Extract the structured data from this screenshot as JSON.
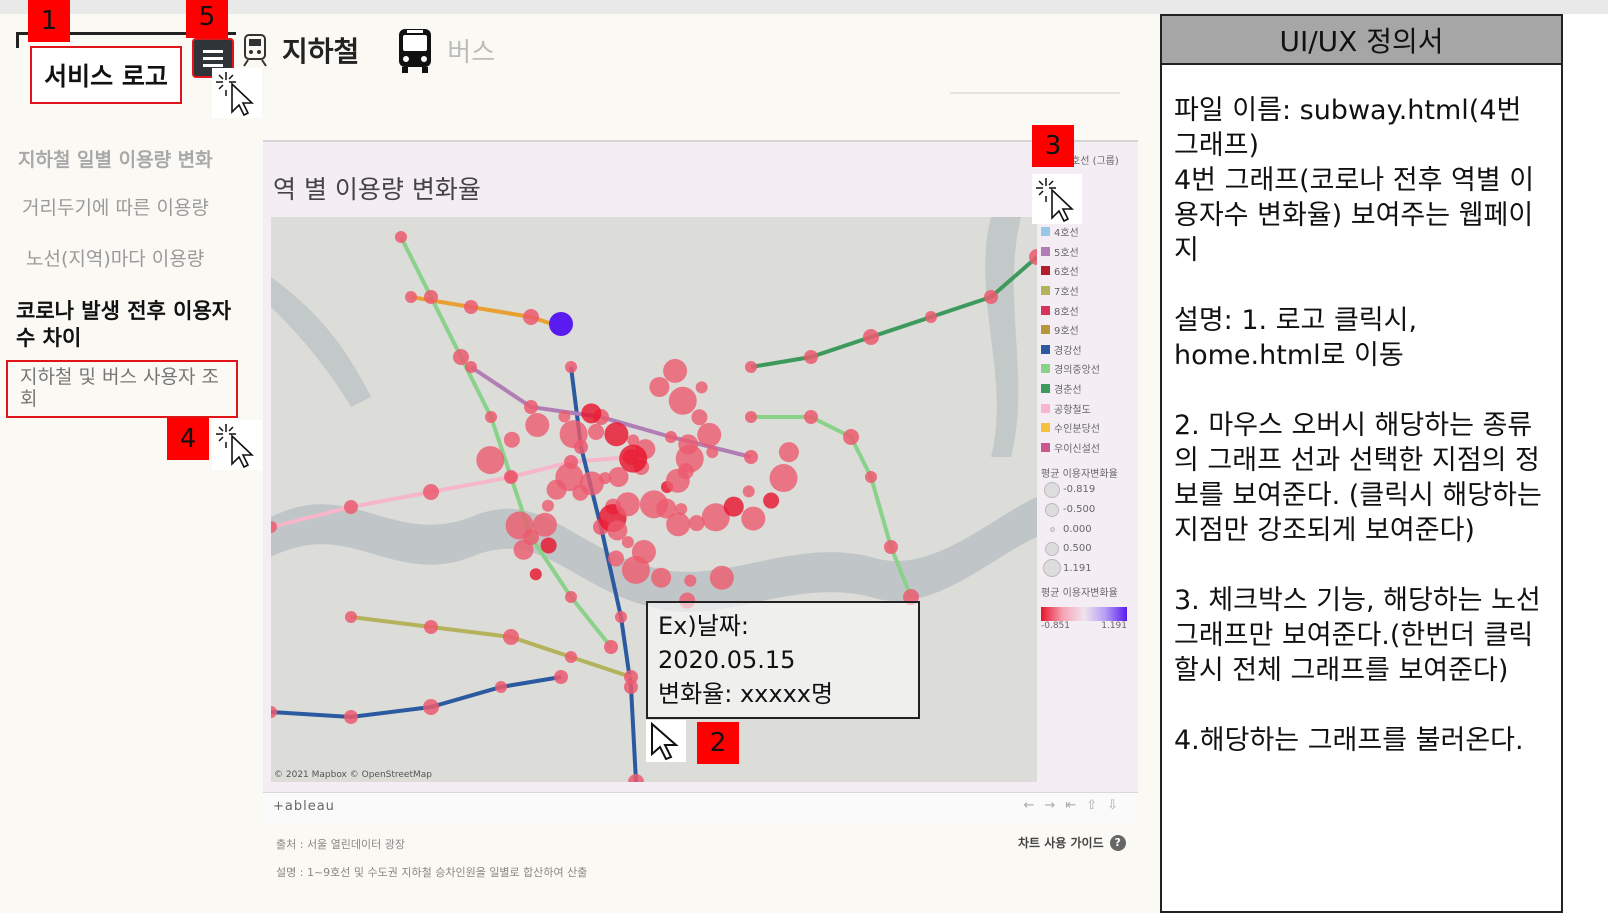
{
  "header": {
    "logo_label": "서비스 로고",
    "nav": [
      {
        "label": "지하철",
        "icon": "train-icon",
        "active": true
      },
      {
        "label": "버스",
        "icon": "bus-icon",
        "active": false
      }
    ]
  },
  "sidebar": {
    "links": [
      "지하철 일별 이용량 변화",
      "거리두기에 따른 이용량",
      "노선(지역)마다 이용량"
    ],
    "section_title": "코로나 발생 전후 이용자 수 차이",
    "active_item": "지하철 및 버스 사용자 조회"
  },
  "chart": {
    "title": "역 별 이용량 변화율",
    "legend_header": "호선 (그룹)",
    "legend_lines": [
      {
        "label": "4호선",
        "color": "#9ac6e8"
      },
      {
        "label": "5호선",
        "color": "#b07db5"
      },
      {
        "label": "6호선",
        "color": "#b71c2d"
      },
      {
        "label": "7호선",
        "color": "#b4b25a"
      },
      {
        "label": "8호선",
        "color": "#d8345a"
      },
      {
        "label": "9호선",
        "color": "#b8963c"
      },
      {
        "label": "경강선",
        "color": "#2c5aa0"
      },
      {
        "label": "경의중앙선",
        "color": "#8ad18a"
      },
      {
        "label": "경춘선",
        "color": "#3d9a5c"
      },
      {
        "label": "공항철도",
        "color": "#f5b7c9"
      },
      {
        "label": "수인분당선",
        "color": "#f3c23d"
      },
      {
        "label": "우이신설선",
        "color": "#c7598f"
      }
    ],
    "size_legend_title": "평균 이용자변화율",
    "size_legend": [
      "-0.819",
      "-0.500",
      "0.000",
      "0.500",
      "1.191"
    ],
    "color_legend_title": "평균 이용자변화율",
    "color_min": "-0.851",
    "color_max": "1.191",
    "map_credit": "© 2021 Mapbox © OpenStreetMap",
    "tableau_label": "+ableau"
  },
  "tooltip": {
    "line1": "Ex)날짜:",
    "line2": "2020.05.15",
    "line3": "변화율: xxxxx명"
  },
  "footer": {
    "source": "출처 : 서울 열린데이터 광장",
    "description": "설명 : 1~9호선 및 수도권 지하철 승차인원을 일별로 합산하여 산출",
    "guide_label": "차트 사용 가이드",
    "guide_icon": "?"
  },
  "annotations": [
    "1",
    "2",
    "3",
    "4",
    "5"
  ],
  "spec": {
    "title": "UI/UX 정의서",
    "body": "파일 이름: subway.html(4번 그래프)\n4번 그래프(코로나 전후 역별 이용자수 변화율) 보여주는 웹페이지\n\n설명: 1. 로고 클릭시, home.html로 이동\n\n2. 마우스 오버시 해당하는 종류의 그래프 선과 선택한 지점의 정보를 보여준다. (클릭시 해당하는 지점만 강조되게 보여준다)\n\n3. 체크박스 기능, 해당하는 노선 그래프만 보여준다.(한번더 클릭할시 전체 그래프를 보여준다)\n\n4.해당하는 그래프를 불러온다."
  },
  "colors": {
    "annotation_red": "#ff0000",
    "spec_header": "#a6a6a6",
    "marker_pink": "#ec5a6e"
  }
}
